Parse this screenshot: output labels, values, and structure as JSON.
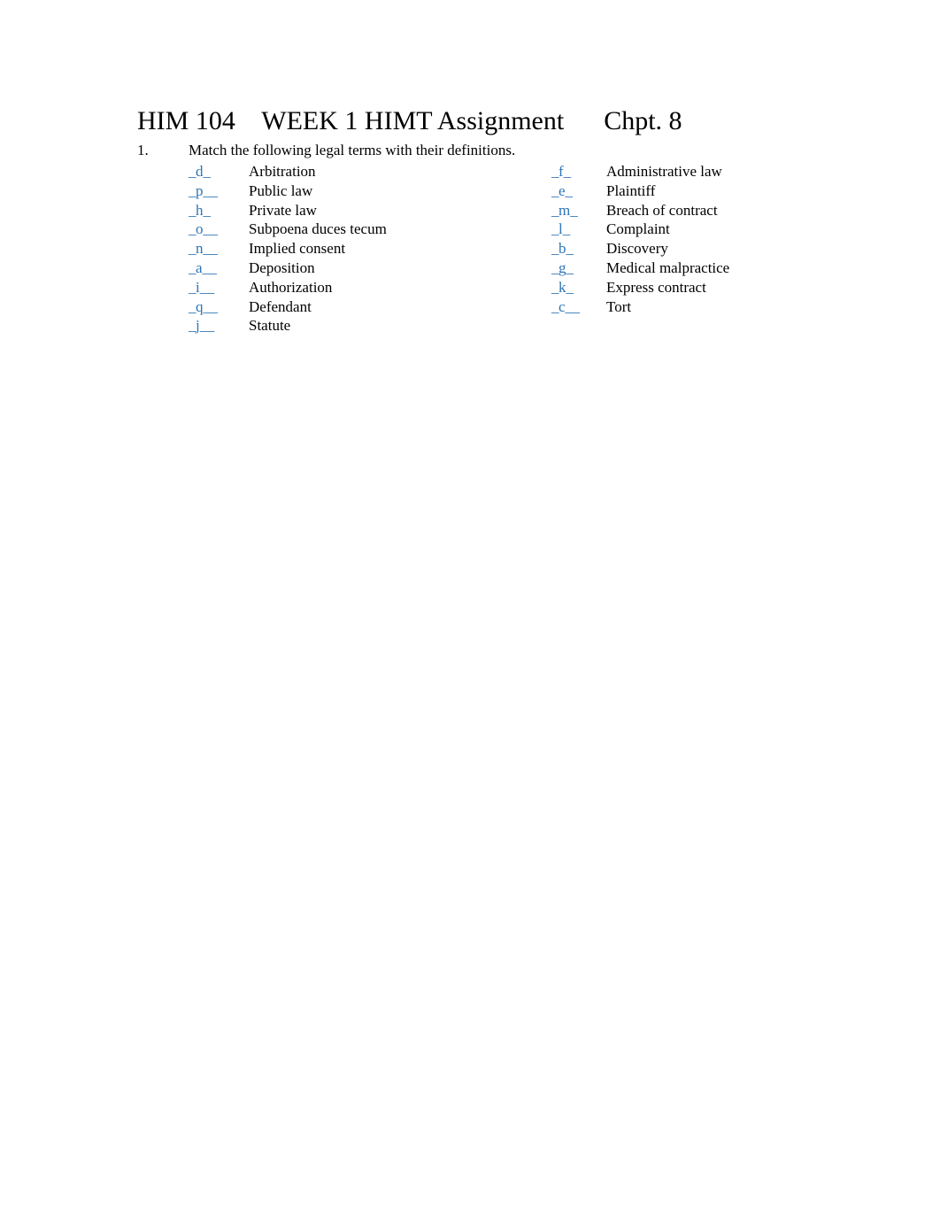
{
  "document": {
    "title": "HIM 104    WEEK 1 HIMT Assignment      Chpt. 8",
    "question_number": "1.",
    "question_text": "Match the following legal terms with their definitions.",
    "answer_color": "#2E74B5",
    "text_color": "#000000",
    "page_background": "#FFFFFF"
  },
  "matching": {
    "left_column": [
      {
        "blank_prefix": "_",
        "answer": "d",
        "blank_suffix": "_",
        "term": "Arbitration"
      },
      {
        "blank_prefix": "_",
        "answer": "p",
        "blank_suffix": "__",
        "term": "Public law"
      },
      {
        "blank_prefix": "_",
        "answer": "h",
        "blank_suffix": "_",
        "term": "Private law"
      },
      {
        "blank_prefix": "_",
        "answer": "o",
        "blank_suffix": "__",
        "term": "Subpoena duces tecum"
      },
      {
        "blank_prefix": "_",
        "answer": "n",
        "blank_suffix": "__",
        "term": "Implied consent"
      },
      {
        "blank_prefix": "_",
        "answer": "a",
        "blank_suffix": "__",
        "term": "Deposition"
      },
      {
        "blank_prefix": "_",
        "answer": "i",
        "blank_suffix": "__",
        "term": "Authorization"
      },
      {
        "blank_prefix": "_",
        "answer": "q",
        "blank_suffix": "__",
        "term": "Defendant"
      },
      {
        "blank_prefix": "_",
        "answer": "j",
        "blank_suffix": "__",
        "term": "Statute"
      }
    ],
    "right_column": [
      {
        "blank_prefix": "_",
        "answer": "f",
        "blank_suffix": "_",
        "term": "Administrative law"
      },
      {
        "blank_prefix": "_",
        "answer": "e",
        "blank_suffix": "_",
        "term": "Plaintiff"
      },
      {
        "blank_prefix": "_",
        "answer": "m",
        "blank_suffix": "_",
        "term": "Breach of contract"
      },
      {
        "blank_prefix": "_",
        "answer": "l",
        "blank_suffix": "_",
        "term": "Complaint"
      },
      {
        "blank_prefix": "_",
        "answer": "b",
        "blank_suffix": "_",
        "term": "Discovery"
      },
      {
        "blank_prefix": "_",
        "answer": "g",
        "blank_suffix": "_",
        "term": "Medical malpractice"
      },
      {
        "blank_prefix": "_",
        "answer": "k",
        "blank_suffix": "_",
        "term": "Express contract"
      },
      {
        "blank_prefix": "_",
        "answer": "c",
        "blank_suffix": "__",
        "term": "Tort"
      },
      {
        "blank_prefix": "",
        "answer": "",
        "blank_suffix": "",
        "term": ""
      }
    ]
  }
}
